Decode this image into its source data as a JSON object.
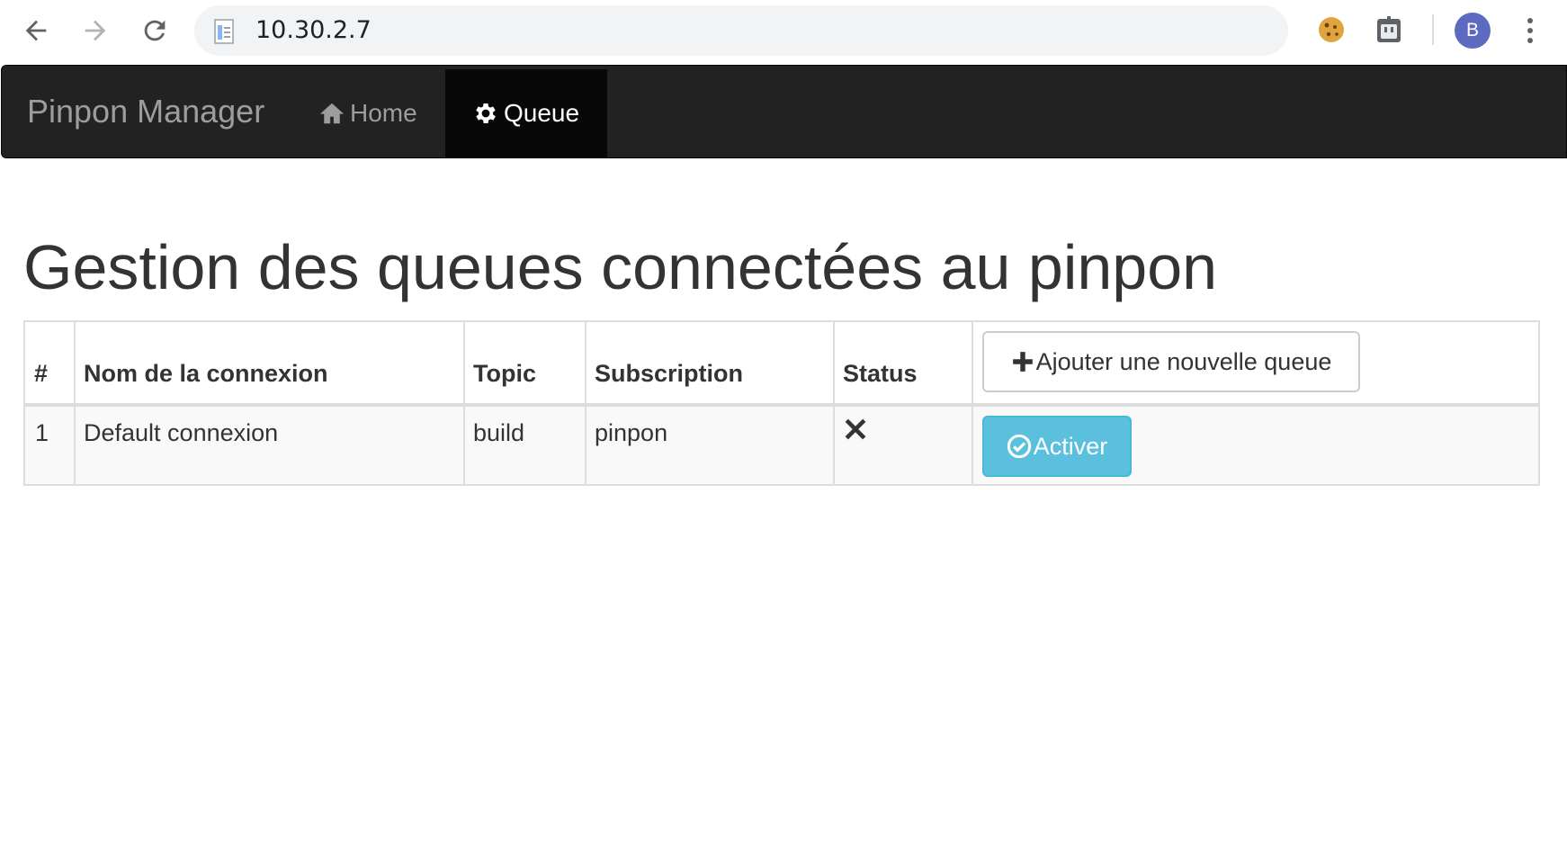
{
  "browser": {
    "url": "10.30.2.7",
    "profile_initial": "B",
    "icons": [
      "back-arrow-icon",
      "forward-arrow-icon",
      "reload-icon",
      "page-icon",
      "cookie-extension-icon",
      "robot-extension-icon",
      "menu-dots-icon"
    ]
  },
  "navbar": {
    "brand": "Pinpon Manager",
    "items": [
      {
        "label": "Home",
        "icon": "home-icon",
        "active": false
      },
      {
        "label": "Queue",
        "icon": "gear-icon",
        "active": true
      }
    ]
  },
  "main": {
    "title": "Gestion des queues connectées au pinpon",
    "table": {
      "headers": [
        "#",
        "Nom de la connexion",
        "Topic",
        "Subscription",
        "Status"
      ],
      "add_button_label": "Ajouter une nouvelle queue",
      "rows": [
        {
          "index": "1",
          "name": "Default connexion",
          "topic": "build",
          "subscription": "pinpon",
          "status_icon": "close-icon",
          "action_label": "Activer"
        }
      ]
    }
  },
  "colors": {
    "navbar_bg": "#222222",
    "navbar_active_bg": "#080808",
    "info_button": "#5bc0de",
    "avatar": "#5c6bc0"
  }
}
